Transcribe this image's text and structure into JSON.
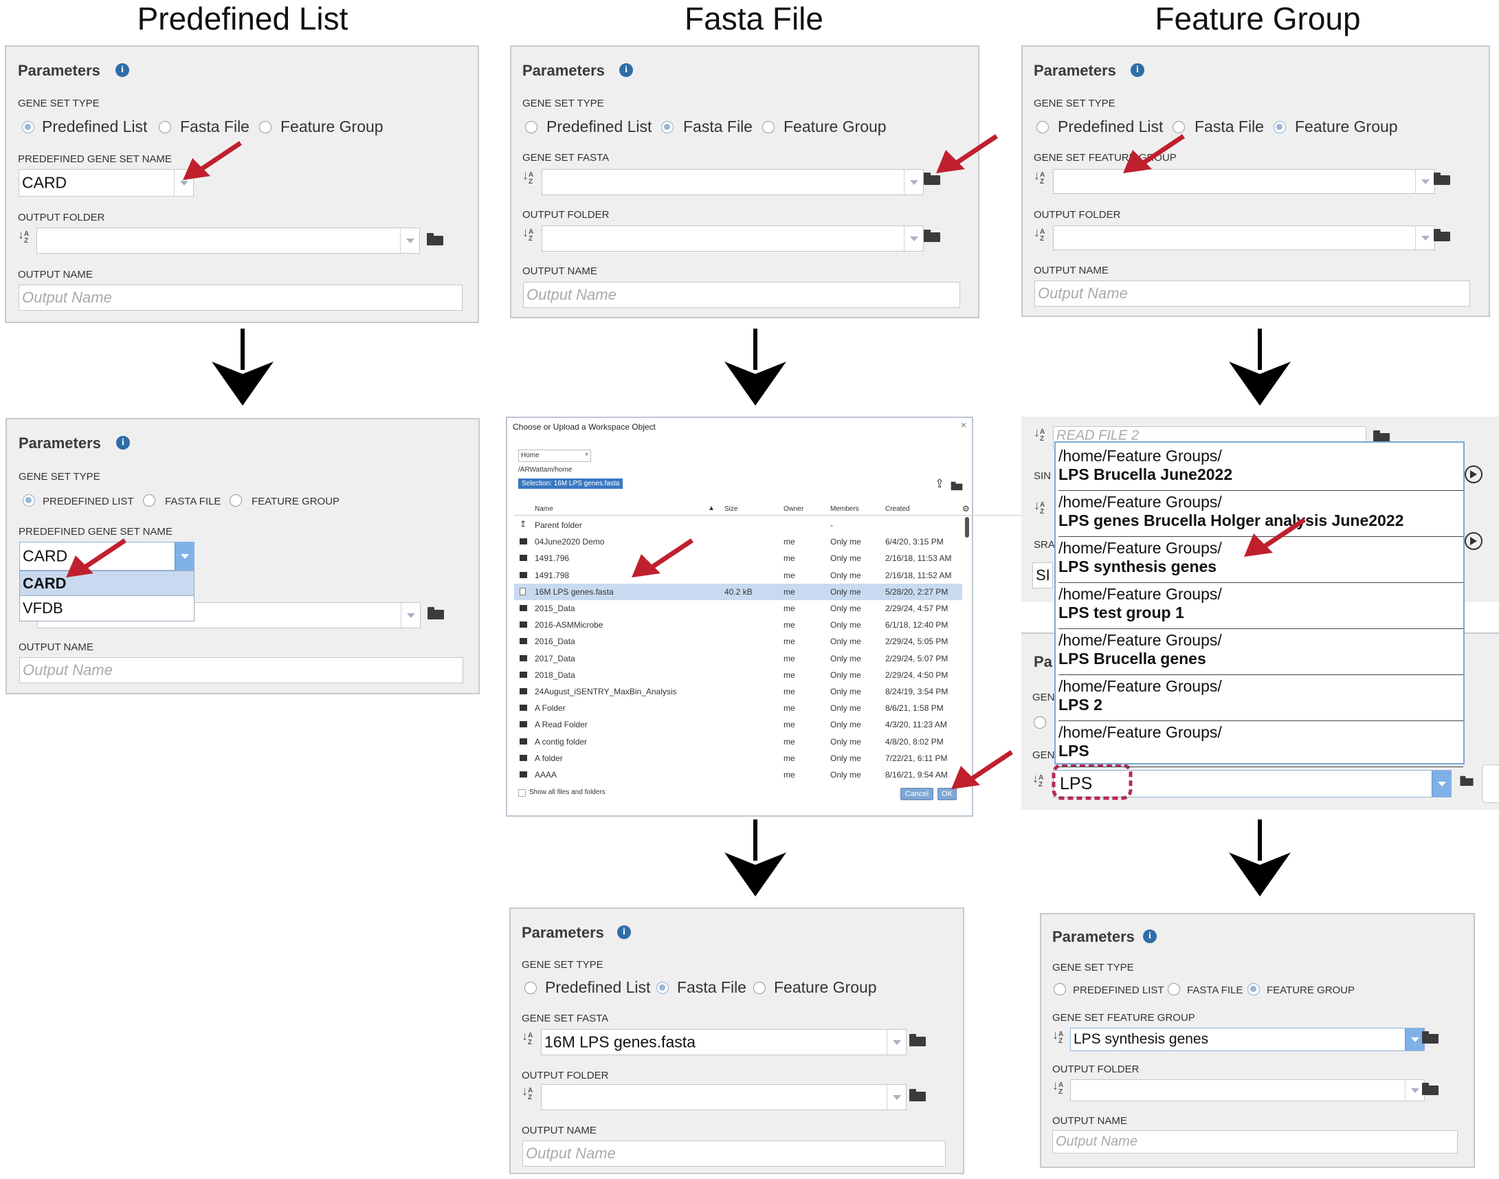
{
  "column_titles": [
    "Predefined List",
    "Fasta File",
    "Feature Group"
  ],
  "common": {
    "parameters": "Parameters",
    "gene_set_type": "GENE SET TYPE",
    "output_folder": "OUTPUT FOLDER",
    "output_name": "OUTPUT NAME",
    "output_name_placeholder": "Output Name",
    "opt_predefined": "Predefined List",
    "opt_fasta": "Fasta File",
    "opt_feature": "Feature Group",
    "opt_predefined_caps": "PREDEFINED LIST",
    "opt_fasta_caps": "FASTA FILE",
    "opt_feature_caps": "FEATURE GROUP"
  },
  "p1": {
    "field_label": "PREDEFINED GENE SET NAME",
    "value": "CARD"
  },
  "p1b": {
    "field_label": "PREDEFINED GENE SET NAME",
    "value": "CARD",
    "options": [
      "CARD",
      "VFDB"
    ]
  },
  "p2": {
    "field_label": "GENE SET FASTA",
    "value": ""
  },
  "p2b": {
    "field_label": "GENE SET FASTA",
    "value": "16M LPS genes.fasta"
  },
  "p3": {
    "field_label": "GENE SET FEATURE GROUP",
    "value": ""
  },
  "p3b": {
    "field_label": "GENE SET FEATURE GROUP",
    "value": "LPS synthesis genes"
  },
  "dialog": {
    "title": "Choose or Upload a Workspace Object",
    "close": "×",
    "location": "Home",
    "path": "/ARWattam/home",
    "selection": "Selection: 16M LPS genes.fasta",
    "columns": [
      "Name",
      "Size",
      "Owner",
      "Members",
      "Created"
    ],
    "rows": [
      {
        "name": "Parent folder",
        "size": "",
        "owner": "",
        "members": "-",
        "created": "",
        "type": "parent"
      },
      {
        "name": "04June2020 Demo",
        "size": "",
        "owner": "me",
        "members": "Only me",
        "created": "6/4/20, 3:15 PM",
        "type": "folder"
      },
      {
        "name": "1491.796",
        "size": "",
        "owner": "me",
        "members": "Only me",
        "created": "2/16/18, 11:53 AM",
        "type": "folder"
      },
      {
        "name": "1491.798",
        "size": "",
        "owner": "me",
        "members": "Only me",
        "created": "2/16/18, 11:52 AM",
        "type": "folder"
      },
      {
        "name": "16M LPS genes.fasta",
        "size": "40.2 kB",
        "owner": "me",
        "members": "Only me",
        "created": "5/28/20, 2:27 PM",
        "type": "file",
        "selected": true
      },
      {
        "name": "2015_Data",
        "size": "",
        "owner": "me",
        "members": "Only me",
        "created": "2/29/24, 4:57 PM",
        "type": "folder"
      },
      {
        "name": "2016-ASMMicrobe",
        "size": "",
        "owner": "me",
        "members": "Only me",
        "created": "6/1/18, 12:40 PM",
        "type": "folder"
      },
      {
        "name": "2016_Data",
        "size": "",
        "owner": "me",
        "members": "Only me",
        "created": "2/29/24, 5:05 PM",
        "type": "folder"
      },
      {
        "name": "2017_Data",
        "size": "",
        "owner": "me",
        "members": "Only me",
        "created": "2/29/24, 5:07 PM",
        "type": "folder"
      },
      {
        "name": "2018_Data",
        "size": "",
        "owner": "me",
        "members": "Only me",
        "created": "2/29/24, 4:50 PM",
        "type": "folder"
      },
      {
        "name": "24August_iSENTRY_MaxBin_Analysis",
        "size": "",
        "owner": "me",
        "members": "Only me",
        "created": "8/24/19, 3:54 PM",
        "type": "folder"
      },
      {
        "name": "A Folder",
        "size": "",
        "owner": "me",
        "members": "Only me",
        "created": "8/6/21, 1:58 PM",
        "type": "folder"
      },
      {
        "name": "A Read Folder",
        "size": "",
        "owner": "me",
        "members": "Only me",
        "created": "4/3/20, 11:23 AM",
        "type": "folder"
      },
      {
        "name": "A contig folder",
        "size": "",
        "owner": "me",
        "members": "Only me",
        "created": "4/8/20, 8:02 PM",
        "type": "folder"
      },
      {
        "name": "A folder",
        "size": "",
        "owner": "me",
        "members": "Only me",
        "created": "7/22/21, 6:11 PM",
        "type": "folder"
      },
      {
        "name": "AAAA",
        "size": "",
        "owner": "me",
        "members": "Only me",
        "created": "8/16/21, 9:54 AM",
        "type": "folder"
      }
    ],
    "show_all": "Show all files and folders",
    "cancel": "Cancel",
    "ok": "OK"
  },
  "fg": {
    "bg_field": "READ FILE 2",
    "bg_labels": [
      "SIN",
      "SRA",
      "SI",
      "Pa",
      "GEN",
      "GEN"
    ],
    "items": [
      {
        "path": "/home/Feature Groups/",
        "name": "LPS Brucella June2022"
      },
      {
        "path": "/home/Feature Groups/",
        "name": "LPS genes Brucella Holger analysis June2022"
      },
      {
        "path": "/home/Feature Groups/",
        "name": "LPS synthesis genes"
      },
      {
        "path": "/home/Feature Groups/",
        "name": "LPS test group 1"
      },
      {
        "path": "/home/Feature Groups/",
        "name": "LPS Brucella genes"
      },
      {
        "path": "/home/Feature Groups/",
        "name": "LPS 2"
      },
      {
        "path": "/home/Feature Groups/",
        "name": "LPS"
      }
    ],
    "typed": "LPS"
  },
  "colors": {
    "accent_red": "#c0202e",
    "panel_bg": "#efeff0",
    "highlight": "#c9daf0",
    "dropdown_blue": "#7fb0e8"
  }
}
